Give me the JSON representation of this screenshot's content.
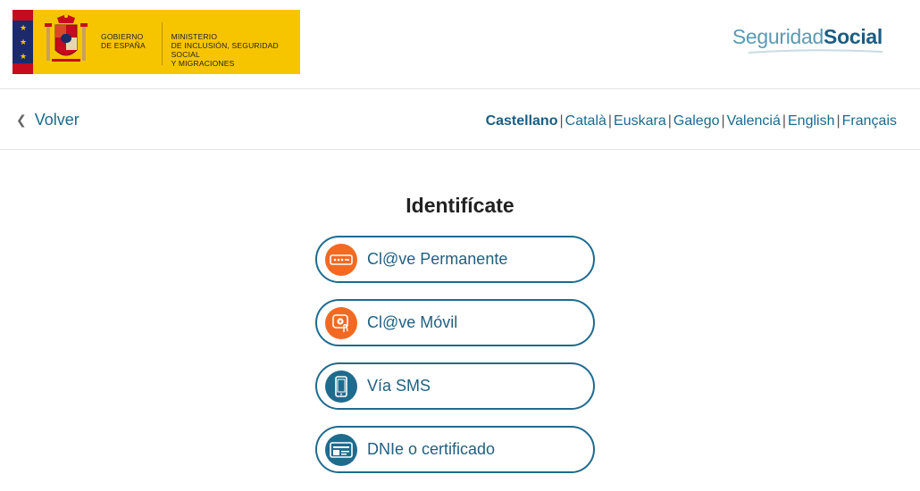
{
  "header": {
    "gov_line1": "GOBIERNO",
    "gov_line2": "DE ESPAÑA",
    "ministry_line1": "MINISTERIO",
    "ministry_line2": "DE INCLUSIÓN, SEGURIDAD SOCIAL",
    "ministry_line3": "Y MIGRACIONES",
    "brand_light": "Seguridad",
    "brand_bold": "Social"
  },
  "nav": {
    "back_label": "Volver",
    "languages": [
      {
        "label": "Castellano",
        "active": true
      },
      {
        "label": "Català"
      },
      {
        "label": "Euskara"
      },
      {
        "label": "Galego"
      },
      {
        "label": "Valenciá"
      },
      {
        "label": "English"
      },
      {
        "label": "Français"
      }
    ]
  },
  "main": {
    "title": "Identifícate",
    "options": [
      {
        "label": "Cl@ve Permanente",
        "icon": "password-field-icon",
        "color": "#f26a21"
      },
      {
        "label": "Cl@ve Móvil",
        "icon": "mobile-tap-icon",
        "color": "#f26a21"
      },
      {
        "label": "Vía SMS",
        "icon": "smartphone-icon",
        "color": "#1f6b8e"
      },
      {
        "label": "DNIe o certificado",
        "icon": "id-card-icon",
        "color": "#1f6b8e"
      }
    ]
  },
  "colors": {
    "accent": "#1f6b8e",
    "orange": "#f26a21",
    "gov_yellow": "#f7c500"
  }
}
